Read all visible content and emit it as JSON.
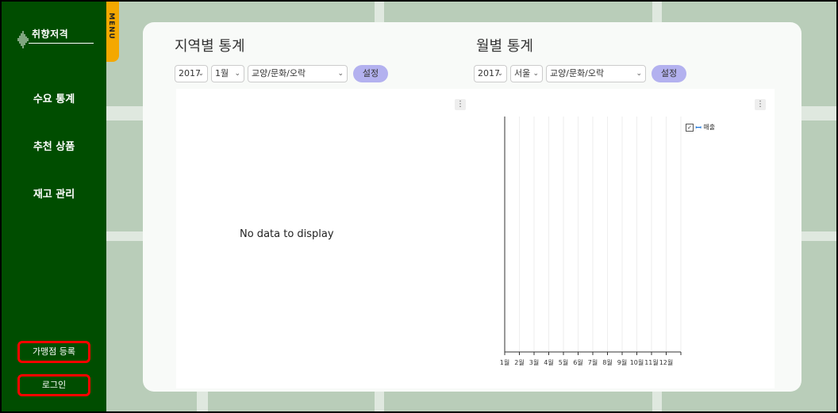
{
  "sidebar": {
    "logo_text": "취향저격",
    "nav": [
      {
        "label": "수요 통계"
      },
      {
        "label": "추천 상품"
      },
      {
        "label": "재고 관리"
      }
    ],
    "store_register": "가맹점 등록",
    "login": "로그인"
  },
  "menu_tab": {
    "label": "MENU"
  },
  "regional": {
    "title": "지역별 통계",
    "year": "2017",
    "month": "1월",
    "category": "교양/문화/오락",
    "set_label": "설정",
    "no_data": "No data to display"
  },
  "monthly": {
    "title": "월별 통계",
    "year": "2017",
    "region": "서울",
    "category": "교양/문화/오락",
    "set_label": "설정"
  },
  "chart_data": {
    "type": "line",
    "categories": [
      "1월",
      "2월",
      "3월",
      "4월",
      "5월",
      "6월",
      "7월",
      "8월",
      "9월",
      "10월",
      "11월",
      "12월"
    ],
    "series": [
      {
        "name": "매출",
        "values": []
      }
    ],
    "legend": "top-right",
    "grid": true
  },
  "colors": {
    "sidebar": "#004d00",
    "menu_tab": "#f4a800",
    "set_button": "#b3b1ef",
    "highlight_border": "#ff0000",
    "series": "#1a74d9"
  },
  "icons": {
    "logo": "sound-wave-icon",
    "kebab": "more-vertical-icon",
    "chevron": "chevron-down-icon",
    "legend_series": "series-swatch-icon"
  }
}
